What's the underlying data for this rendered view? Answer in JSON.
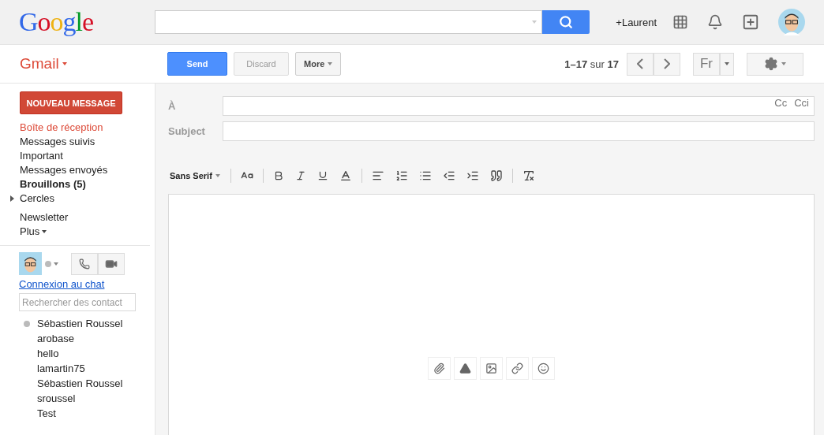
{
  "header": {
    "logo": "Google",
    "user": "+Laurent"
  },
  "actionbar": {
    "app": "Gmail",
    "buttons": [
      {
        "label": "Send",
        "kind": "primary"
      },
      {
        "label": "Discard",
        "kind": "disabled"
      },
      {
        "label": "More",
        "kind": "menu"
      }
    ],
    "pager": "**1–17** sur **17**",
    "language": "Fr"
  },
  "sidebar": {
    "compose": "NOUVEAU MESSAGE",
    "items": [
      {
        "label": "Boîte de réception",
        "selected": true,
        "unread": false
      },
      {
        "label": "Messages suivis",
        "selected": false,
        "unread": false
      },
      {
        "label": "Important",
        "selected": false,
        "unread": false
      },
      {
        "label": "Messages envoyés",
        "selected": false,
        "unread": false
      },
      {
        "label": "Brouillons (5)",
        "selected": false,
        "unread": true
      },
      {
        "label": "Cercles",
        "selected": false,
        "unread": false,
        "expanded": false
      }
    ],
    "extra": [
      "Newsletter",
      "Plus"
    ],
    "chat": {
      "link": "Connexion au chat",
      "search": {
        "placeholder": "Rechercher des contact"
      },
      "contacts": [
        {
          "name": "Sébastien Roussel",
          "online": false
        },
        {
          "name": "arobase"
        },
        {
          "name": "hello"
        },
        {
          "name": "lamartin75"
        },
        {
          "name": "Sébastien Roussel"
        },
        {
          "name": "sroussel"
        },
        {
          "name": "Test"
        }
      ]
    }
  },
  "compose": {
    "to_label": "À",
    "cc": "Cc",
    "bcc": "Cci",
    "subject_label": "Subject",
    "font": "Sans Serif"
  }
}
